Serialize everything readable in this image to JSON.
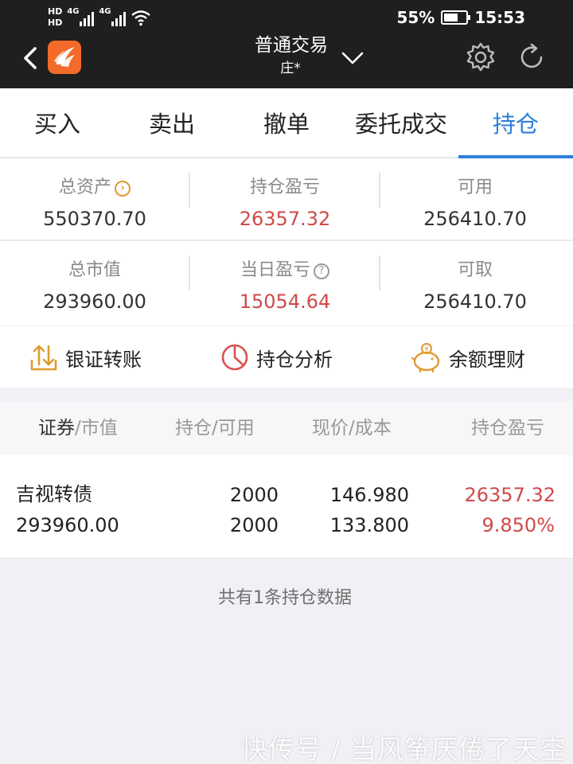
{
  "status_bar": {
    "hd_top": "HD",
    "hd_bottom": "HD",
    "net1": "4G",
    "net2": "4G",
    "battery": "55%",
    "time": "15:53"
  },
  "nav": {
    "title": "普通交易",
    "subtitle": "庄*"
  },
  "tabs": [
    {
      "label": "买入"
    },
    {
      "label": "卖出"
    },
    {
      "label": "撤单"
    },
    {
      "label": "委托成交"
    },
    {
      "label": "持仓",
      "active": true
    }
  ],
  "summary": {
    "total_assets_label": "总资产",
    "total_assets": "550370.70",
    "position_pnl_label": "持仓盈亏",
    "position_pnl": "26357.32",
    "available_label": "可用",
    "available": "256410.70",
    "market_value_label": "总市值",
    "market_value": "293960.00",
    "daily_pnl_label": "当日盈亏",
    "daily_pnl": "15054.64",
    "withdrawable_label": "可取",
    "withdrawable": "256410.70"
  },
  "actions": {
    "transfer": "银证转账",
    "analysis": "持仓分析",
    "wealth": "余额理财"
  },
  "table": {
    "col1_a": "证券",
    "col1_b": "/市值",
    "col2": "持仓/可用",
    "col3": "现价/成本",
    "col4": "持仓盈亏",
    "rows": [
      {
        "name": "吉视转债",
        "market_value": "293960.00",
        "holding": "2000",
        "available": "2000",
        "price": "146.980",
        "cost": "133.800",
        "pnl": "26357.32",
        "pnl_pct": "9.850%"
      }
    ]
  },
  "footer_note": "共有1条持仓数据",
  "watermark": "快传号 / 当风筝厌倦了天空",
  "colors": {
    "accent": "#2e7fd8",
    "profit": "#cf4a4a",
    "topbar": "#1f1f1f",
    "logo": "#f26b2a"
  }
}
